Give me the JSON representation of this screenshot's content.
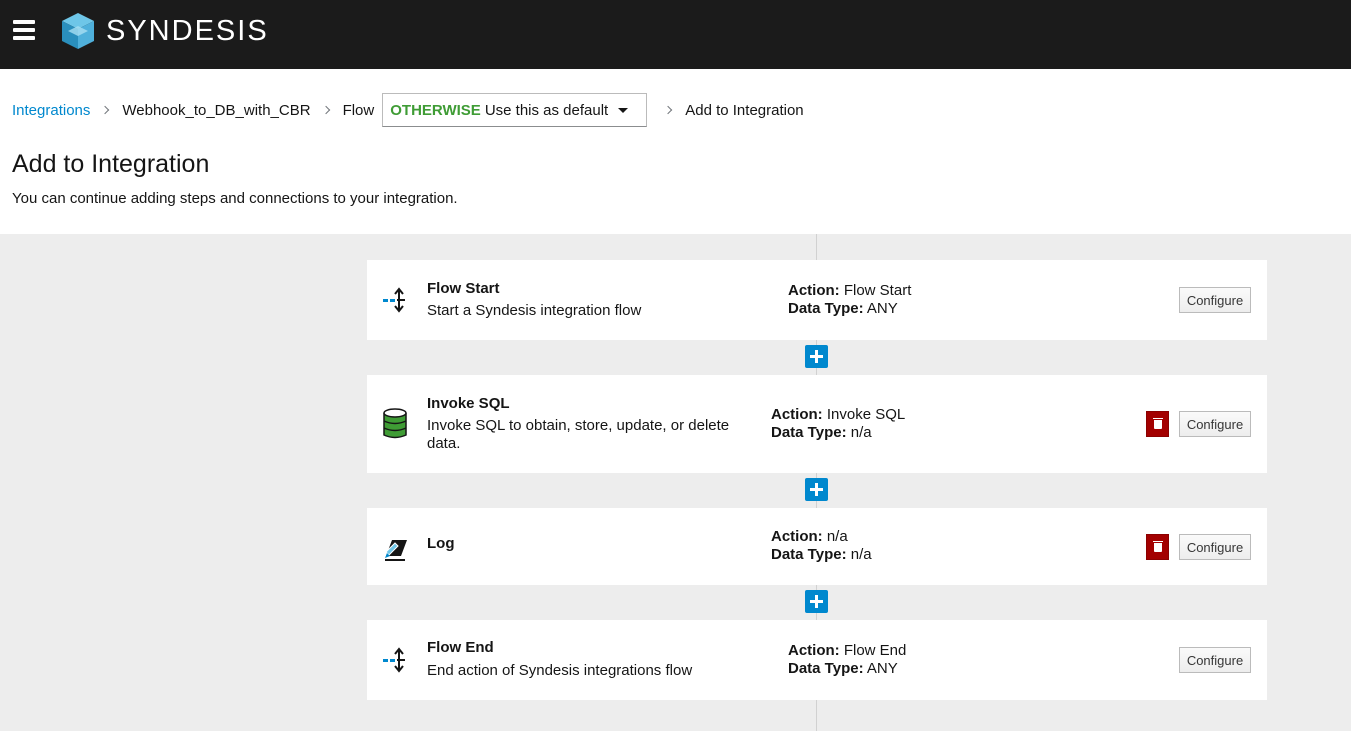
{
  "app": {
    "brand": "SYNDESIS"
  },
  "header": {
    "menu_icon": "hamburger-menu-icon",
    "logo_icon": "syndesis-logo-icon"
  },
  "breadcrumb": {
    "integrations": "Integrations",
    "integration_name": "Webhook_to_DB_with_CBR",
    "flow": "Flow",
    "flow_select": {
      "condition": "OTHERWISE",
      "label": "Use this as default"
    },
    "current": "Add to Integration"
  },
  "page": {
    "title": "Add to Integration",
    "subtitle": "You can continue adding steps and connections to your integration."
  },
  "labels": {
    "action": "Action:",
    "data_type": "Data Type:",
    "configure": "Configure"
  },
  "steps": [
    {
      "name": "Flow Start",
      "description": "Start a Syndesis integration flow",
      "action": "Flow Start",
      "data_type": "ANY",
      "icon": "flow-start-icon",
      "deletable": false
    },
    {
      "name": "Invoke SQL",
      "description": "Invoke SQL to obtain, store, update, or delete data.",
      "action": "Invoke SQL",
      "data_type": "n/a",
      "icon": "database-icon",
      "deletable": true
    },
    {
      "name": "Log",
      "description": "",
      "action": "n/a",
      "data_type": "n/a",
      "icon": "log-icon",
      "deletable": true
    },
    {
      "name": "Flow End",
      "description": "End action of Syndesis integrations flow",
      "action": "Flow End",
      "data_type": "ANY",
      "icon": "flow-end-icon",
      "deletable": false
    }
  ],
  "colors": {
    "accent": "#0088ce",
    "condition": "#3f9c35",
    "danger": "#a30000",
    "topbar": "#1b1b1b",
    "canvas": "#ededed"
  }
}
